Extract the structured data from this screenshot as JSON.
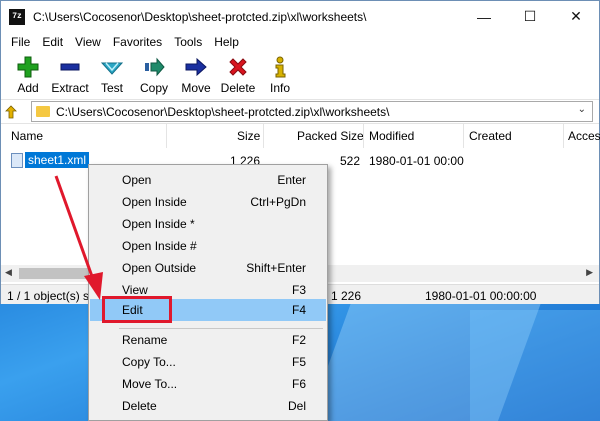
{
  "window": {
    "title": "C:\\Users\\Cocosenor\\Desktop\\sheet-protcted.zip\\xl\\worksheets\\",
    "app_icon_text": "7z",
    "controls": [
      "minimize",
      "maximize",
      "close"
    ]
  },
  "menu": [
    "File",
    "Edit",
    "View",
    "Favorites",
    "Tools",
    "Help"
  ],
  "toolbar": [
    {
      "label": "Add",
      "icon": "plus-icon",
      "color": "#1fa11f"
    },
    {
      "label": "Extract",
      "icon": "minus-icon",
      "color": "#1a2fa0"
    },
    {
      "label": "Test",
      "icon": "check-icon",
      "color": "#2aa6c4"
    },
    {
      "label": "Copy",
      "icon": "copy-arrow-icon",
      "color": "#1f8a6a"
    },
    {
      "label": "Move",
      "icon": "move-arrow-icon",
      "color": "#1a2fa0"
    },
    {
      "label": "Delete",
      "icon": "delete-x-icon",
      "color": "#d9141f"
    },
    {
      "label": "Info",
      "icon": "info-icon",
      "color": "#d7b200"
    }
  ],
  "address": {
    "path": "C:\\Users\\Cocosenor\\Desktop\\sheet-protcted.zip\\xl\\worksheets\\"
  },
  "columns": [
    "Name",
    "Size",
    "Packed Size",
    "Modified",
    "Created",
    "Acces"
  ],
  "files": [
    {
      "name": "sheet1.xml",
      "size": "1 226",
      "packed": "522",
      "modified": "1980-01-01 00:00"
    }
  ],
  "status": {
    "selection": "1 / 1 object(s) se",
    "size": "1 226",
    "modified": "1980-01-01 00:00:00"
  },
  "context_menu": {
    "items": [
      {
        "label": "Open",
        "shortcut": "Enter"
      },
      {
        "label": "Open Inside",
        "shortcut": "Ctrl+PgDn"
      },
      {
        "label": "Open Inside *",
        "shortcut": ""
      },
      {
        "label": "Open Inside #",
        "shortcut": ""
      },
      {
        "label": "Open Outside",
        "shortcut": "Shift+Enter"
      },
      {
        "label": "View",
        "shortcut": "F3"
      },
      {
        "label": "Edit",
        "shortcut": "F4",
        "highlighted": true
      },
      {
        "label": "Rename",
        "shortcut": "F2"
      },
      {
        "label": "Copy To...",
        "shortcut": "F5"
      },
      {
        "label": "Move To...",
        "shortcut": "F6"
      },
      {
        "label": "Delete",
        "shortcut": "Del"
      }
    ]
  },
  "colors": {
    "selection": "#0078d7",
    "menu_highlight": "#91c9f7",
    "annotation": "#e0182c"
  }
}
